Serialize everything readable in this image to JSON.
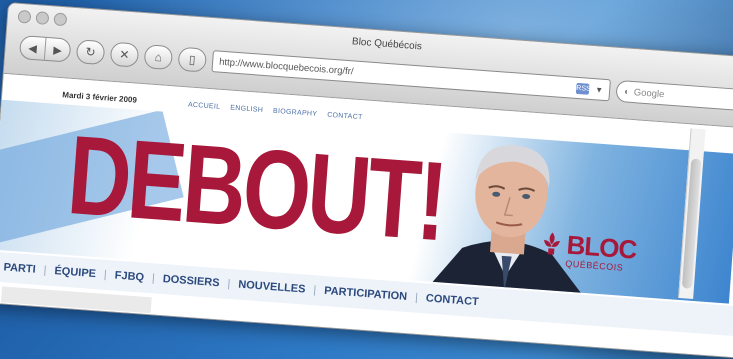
{
  "window": {
    "title": "Bloc Québécois"
  },
  "toolbar": {
    "url": "http://www.blocquebecois.org/fr/",
    "search_placeholder": "Google"
  },
  "page": {
    "date": "Mardi 3 février 2009",
    "top_links": [
      "ACCUEIL",
      "ENGLISH",
      "BIOGRAPHY",
      "CONTACT"
    ],
    "headline": "DEBOUT!",
    "logo_main": "BLOC",
    "logo_sub": "QUÉBÉCOIS",
    "nav_items": [
      "PARTI",
      "ÉQUIPE",
      "FJBQ",
      "DOSSIERS",
      "NOUVELLES",
      "PARTICIPATION",
      "CONTACT"
    ]
  },
  "colors": {
    "brand_red": "#a8183a",
    "brand_blue": "#3d85cf"
  }
}
